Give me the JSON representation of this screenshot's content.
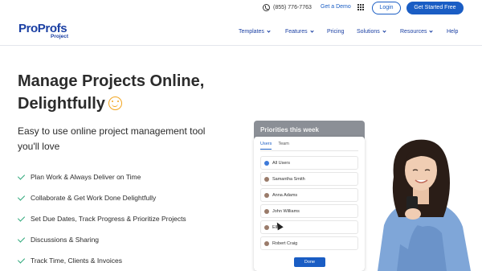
{
  "topbar": {
    "phone": "(855) 776-7763",
    "get_demo": "Get a Demo",
    "login": "Login",
    "cta": "Get Started Free"
  },
  "brand": {
    "logo_text": "ProProfs",
    "logo_sub": "Project"
  },
  "nav": {
    "items": [
      {
        "label": "Templates"
      },
      {
        "label": "Features"
      },
      {
        "label": "Pricing"
      },
      {
        "label": "Solutions"
      },
      {
        "label": "Resources"
      },
      {
        "label": "Help"
      }
    ]
  },
  "hero": {
    "title_line1": "Manage Projects Online,",
    "title_line2": "Delightfully",
    "subtitle": "Easy to use online project management tool you'll love",
    "features": [
      "Plan Work & Always Deliver on Time",
      "Collaborate & Get Work Done Delightfully",
      "Set Due Dates, Track Progress & Prioritize Projects",
      "Discussions & Sharing",
      "Track Time, Clients & Invoices"
    ]
  },
  "app_mock": {
    "card_title": "Priorities this week",
    "tabs": [
      "Users",
      "Team"
    ],
    "users": [
      "All Users",
      "Samantha Smith",
      "Anna Adams",
      "John Williams",
      "Ella",
      "Robert Craig"
    ],
    "done": "Done"
  },
  "colors": {
    "brand_blue": "#1a5dc4",
    "logo_blue": "#1a3fa3",
    "accent_orange": "#f2a51f",
    "check_green": "#2fa87b"
  }
}
